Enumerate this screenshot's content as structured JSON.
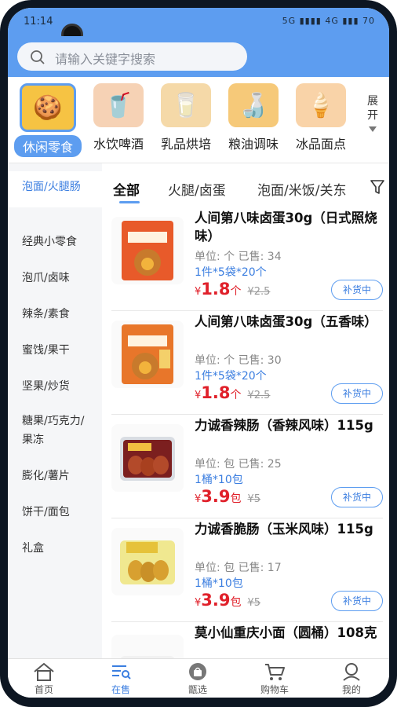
{
  "status_bar": {
    "time": "11:14",
    "indicators": "5G ▮▮▮▮ 4G ▮▮▮ 70"
  },
  "search": {
    "placeholder": "请输入关键字搜索"
  },
  "categories": [
    {
      "label": "休闲零食",
      "icon": "snack-icon",
      "glyph": "🍪",
      "bg": "#f6c343"
    },
    {
      "label": "水饮啤酒",
      "icon": "drink-icon",
      "glyph": "🥤",
      "bg": "#f6d2b5"
    },
    {
      "label": "乳品烘培",
      "icon": "dairy-icon",
      "glyph": "🥛",
      "bg": "#f5d9a8"
    },
    {
      "label": "粮油调味",
      "icon": "oil-icon",
      "glyph": "🍶",
      "bg": "#f6c979"
    },
    {
      "label": "冰品面点",
      "icon": "icecream-icon",
      "glyph": "🍦",
      "bg": "#f9d3a8"
    }
  ],
  "expand_label": "展开",
  "sidebar": [
    "泡面/火腿肠",
    "经典小零食",
    "泡爪/卤味",
    "辣条/素食",
    "蜜饯/果干",
    "坚果/炒货",
    "糖果/巧克力/果冻",
    "膨化/薯片",
    "饼干/面包",
    "礼盒"
  ],
  "tabs": [
    "全部",
    "火腿/卤蛋",
    "泡面/米饭/关东"
  ],
  "products": [
    {
      "name": "人间第八味卤蛋30g（日式照烧味）",
      "unit_label": "单位:",
      "unit": "个",
      "sold_label": "已售:",
      "sold": "34",
      "pack": "1件*5袋*20个",
      "currency": "¥",
      "price": "1.8",
      "price_unit": "个",
      "old_price": "¥2.5",
      "button": "补货中"
    },
    {
      "name": "人间第八味卤蛋30g（五香味）",
      "unit_label": "单位:",
      "unit": "个",
      "sold_label": "已售:",
      "sold": "30",
      "pack": "1件*5袋*20个",
      "currency": "¥",
      "price": "1.8",
      "price_unit": "个",
      "old_price": "¥2.5",
      "button": "补货中"
    },
    {
      "name": "力诚香辣肠（香辣风味）115g",
      "unit_label": "单位:",
      "unit": "包",
      "sold_label": "已售:",
      "sold": "25",
      "pack": "1桶*10包",
      "currency": "¥",
      "price": "3.9",
      "price_unit": "包",
      "old_price": "¥5",
      "button": "补货中"
    },
    {
      "name": "力诚香脆肠（玉米风味）115g",
      "unit_label": "单位:",
      "unit": "包",
      "sold_label": "已售:",
      "sold": "17",
      "pack": "1桶*10包",
      "currency": "¥",
      "price": "3.9",
      "price_unit": "包",
      "old_price": "¥5",
      "button": "补货中"
    },
    {
      "name": "莫小仙重庆小面（圆桶）108克"
    }
  ],
  "bottom_nav": [
    {
      "label": "首页",
      "icon": "home-icon"
    },
    {
      "label": "在售",
      "icon": "list-search-icon"
    },
    {
      "label": "甑选",
      "icon": "bag-icon"
    },
    {
      "label": "购物车",
      "icon": "cart-icon"
    },
    {
      "label": "我的",
      "icon": "user-icon"
    }
  ],
  "colors": {
    "accent": "#5d9df0",
    "price": "#e0202a",
    "link": "#3b7ee0"
  }
}
